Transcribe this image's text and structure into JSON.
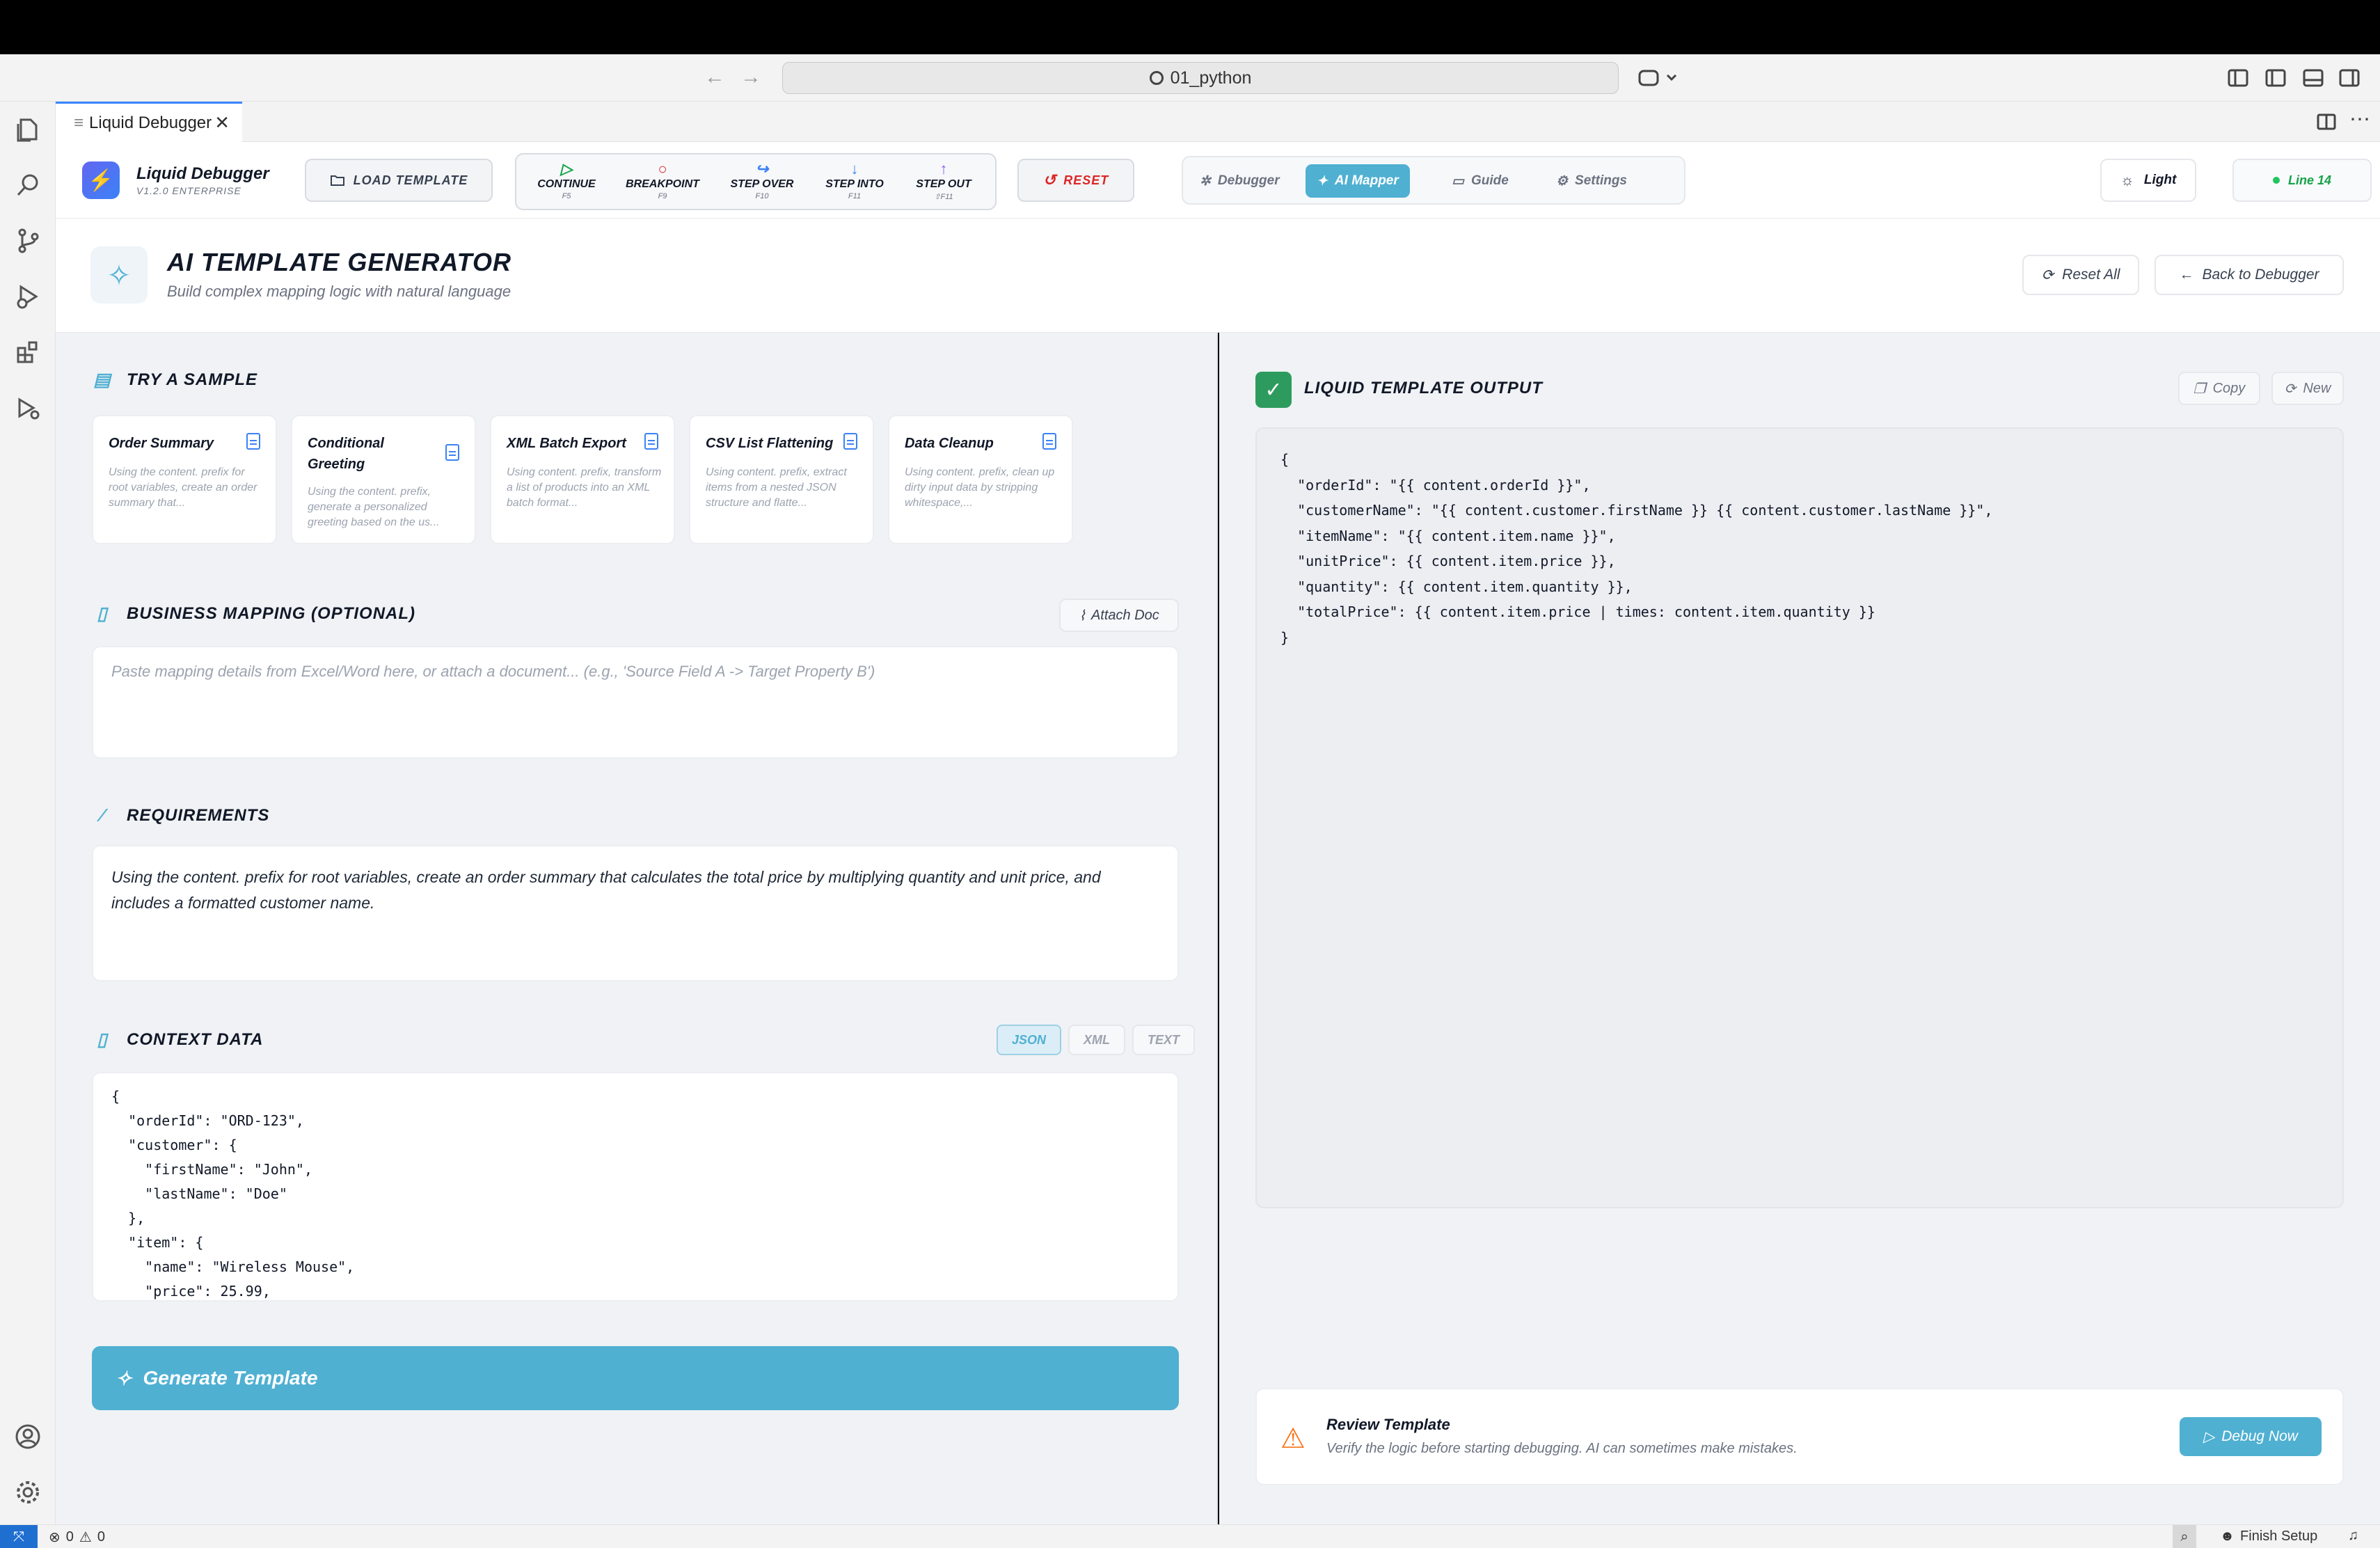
{
  "window": {
    "search_text": "01_python",
    "tab_title": "Liquid Debugger",
    "tab_close": "✕"
  },
  "header": {
    "brand_name": "Liquid Debugger",
    "brand_version": "V1.2.0 ENTERPRISE",
    "load_template": "LOAD TEMPLATE",
    "steps": [
      {
        "label": "CONTINUE",
        "key": "F5"
      },
      {
        "label": "BREAKPOINT",
        "key": "F9"
      },
      {
        "label": "STEP OVER",
        "key": "F10"
      },
      {
        "label": "STEP INTO",
        "key": "F11"
      },
      {
        "label": "STEP OUT",
        "key": "⇧F11"
      }
    ],
    "reset": "RESET",
    "view_tabs": [
      {
        "label": "Debugger"
      },
      {
        "label": "AI Mapper"
      },
      {
        "label": "Guide"
      },
      {
        "label": "Settings"
      }
    ],
    "theme": "Light",
    "line_badge": "Line 14"
  },
  "page": {
    "title": "AI TEMPLATE GENERATOR",
    "subtitle": "Build complex mapping logic with natural language",
    "reset_all": "Reset All",
    "back": "Back to Debugger"
  },
  "samples": {
    "heading": "TRY A SAMPLE",
    "cards": [
      {
        "title": "Order Summary",
        "desc": "Using the content. prefix for root variables, create an order summary that..."
      },
      {
        "title": "Conditional Greeting",
        "desc": "Using the content. prefix, generate a personalized greeting based on the us..."
      },
      {
        "title": "XML Batch Export",
        "desc": "Using content. prefix, transform a list of products into an XML batch format..."
      },
      {
        "title": "CSV List Flattening",
        "desc": "Using content. prefix, extract items from a nested JSON structure and flatte..."
      },
      {
        "title": "Data Cleanup",
        "desc": "Using content. prefix, clean up dirty input data by stripping whitespace,..."
      }
    ]
  },
  "mapping": {
    "heading": "BUSINESS MAPPING (OPTIONAL)",
    "attach": "Attach Doc",
    "placeholder": "Paste mapping details from Excel/Word here, or attach a document... (e.g., 'Source Field A -> Target Property B')"
  },
  "requirements": {
    "heading": "REQUIREMENTS",
    "text": "Using the content. prefix for root variables, create an order summary that calculates the total price by multiplying quantity and unit price, and includes a formatted customer name."
  },
  "context": {
    "heading": "CONTEXT DATA",
    "formats": [
      "JSON",
      "XML",
      "TEXT"
    ],
    "code": "{\n  \"orderId\": \"ORD-123\",\n  \"customer\": {\n    \"firstName\": \"John\",\n    \"lastName\": \"Doe\"\n  },\n  \"item\": {\n    \"name\": \"Wireless Mouse\",\n    \"price\": 25.99,"
  },
  "generate": "Generate Template",
  "output": {
    "heading": "LIQUID TEMPLATE OUTPUT",
    "copy": "Copy",
    "new": "New",
    "code": "{\n  \"orderId\": \"{{ content.orderId }}\",\n  \"customerName\": \"{{ content.customer.firstName }} {{ content.customer.lastName }}\",\n  \"itemName\": \"{{ content.item.name }}\",\n  \"unitPrice\": {{ content.item.price }},\n  \"quantity\": {{ content.item.quantity }},\n  \"totalPrice\": {{ content.item.price | times: content.item.quantity }}\n}"
  },
  "review": {
    "title": "Review Template",
    "subtitle": "Verify the logic before starting debugging. AI can sometimes make mistakes.",
    "button": "Debug Now"
  },
  "statusbar": {
    "problems": "0",
    "warnings": "0",
    "finish_setup": "Finish Setup"
  },
  "colors": {
    "accent": "#4fb0d2",
    "success": "#2e9b5e",
    "danger": "#dc2626",
    "warning": "#f97316"
  }
}
